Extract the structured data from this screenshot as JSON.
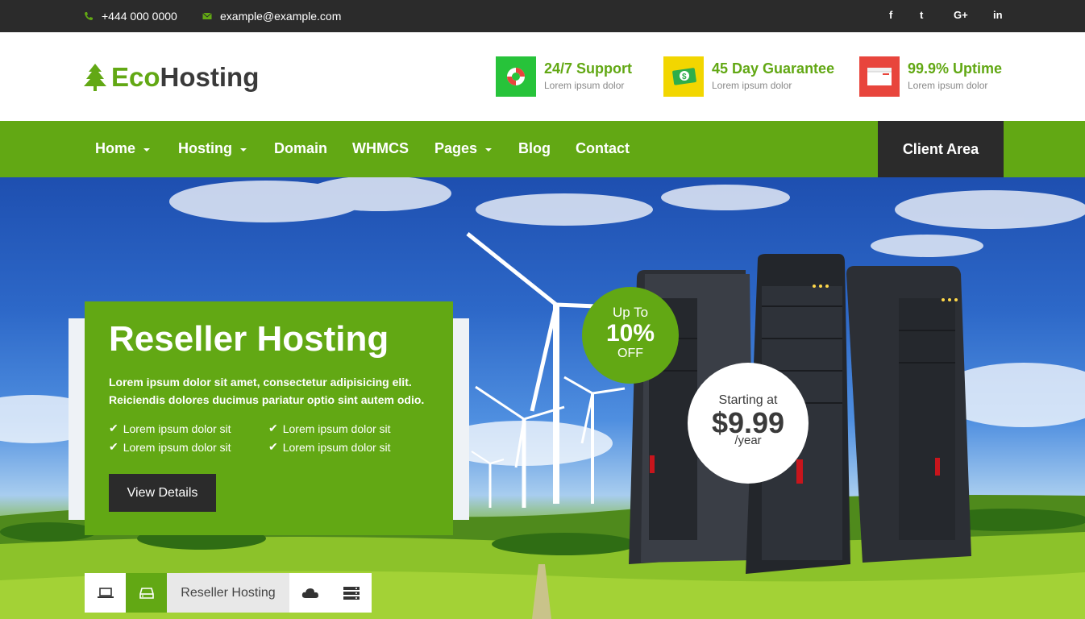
{
  "topbar": {
    "phone": "+444 000 0000",
    "email": "example@example.com",
    "social": [
      "f",
      "t",
      "G+",
      "in"
    ],
    "social_icons": [
      "facebook-icon",
      "twitter-icon",
      "google-plus-icon",
      "linkedin-icon"
    ]
  },
  "brand": {
    "prefix": "Eco",
    "suffix": "Hosting"
  },
  "features": [
    {
      "title": "24/7 Support",
      "subtitle": "Lorem ipsum dolor",
      "icon": "lifebuoy-icon",
      "color": "#27c33a"
    },
    {
      "title": "45 Day Guarantee",
      "subtitle": "Lorem ipsum dolor",
      "icon": "money-icon",
      "color": "#f2d600"
    },
    {
      "title": "99.9% Uptime",
      "subtitle": "Lorem ipsum dolor",
      "icon": "browser-icon",
      "color": "#e8453c"
    }
  ],
  "nav": {
    "items": [
      "Home",
      "Hosting",
      "Domain",
      "WHMCS",
      "Pages",
      "Blog",
      "Contact"
    ],
    "client_area": "Client Area"
  },
  "hero": {
    "title": "Reseller Hosting",
    "description_line1": "Lorem ipsum dolor sit amet, consectetur adipisicing elit.",
    "description_line2": "Reiciendis dolores ducimus pariatur optio sint autem odio.",
    "bullets": [
      "Lorem ipsum dolor sit",
      "Lorem ipsum dolor sit",
      "Lorem ipsum dolor sit",
      "Lorem ipsum dolor sit"
    ],
    "button": "View Details",
    "discount": {
      "up_to": "Up To",
      "percent": "10%",
      "off": "OFF"
    },
    "price": {
      "starting": "Starting at",
      "amount": "$9.99",
      "period": "/year"
    }
  },
  "tabs": {
    "active_label": "Reseller Hosting",
    "icons": [
      "laptop-icon",
      "drive-icon",
      "cloud-icon",
      "server-icon"
    ]
  },
  "colors": {
    "brand_green": "#62a814",
    "dark": "#2b2b2b"
  }
}
